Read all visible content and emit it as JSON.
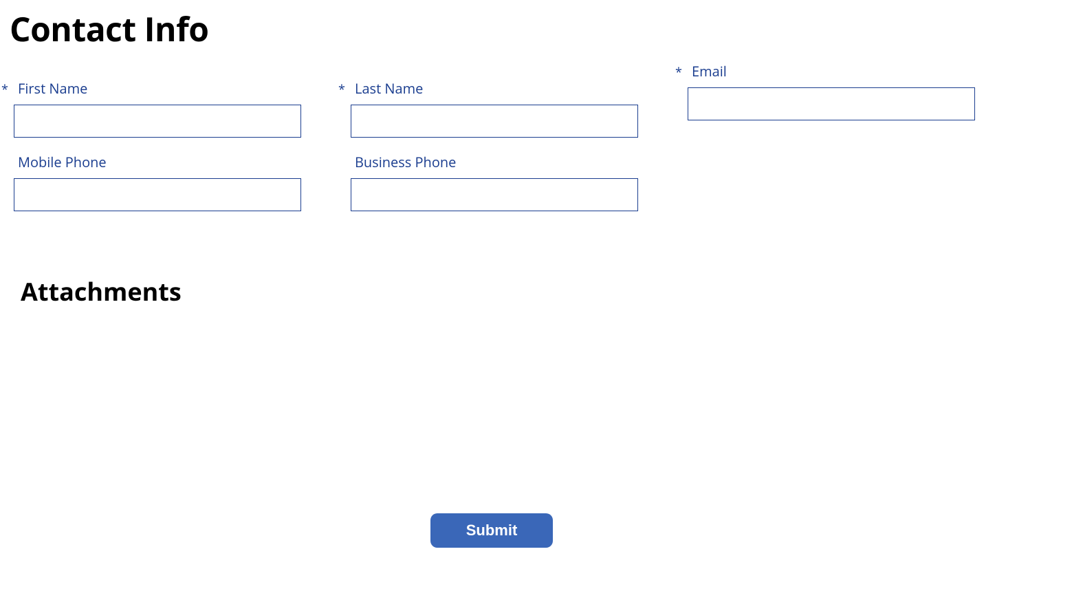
{
  "page": {
    "title": "Contact Info",
    "attachments_title": "Attachments"
  },
  "form": {
    "required_mark": "*",
    "fields": {
      "first_name": {
        "label": "First Name",
        "value": ""
      },
      "last_name": {
        "label": "Last Name",
        "value": ""
      },
      "email": {
        "label": "Email",
        "value": ""
      },
      "mobile_phone": {
        "label": "Mobile Phone",
        "value": ""
      },
      "business_phone": {
        "label": "Business Phone",
        "value": ""
      }
    },
    "submit_label": "Submit"
  }
}
